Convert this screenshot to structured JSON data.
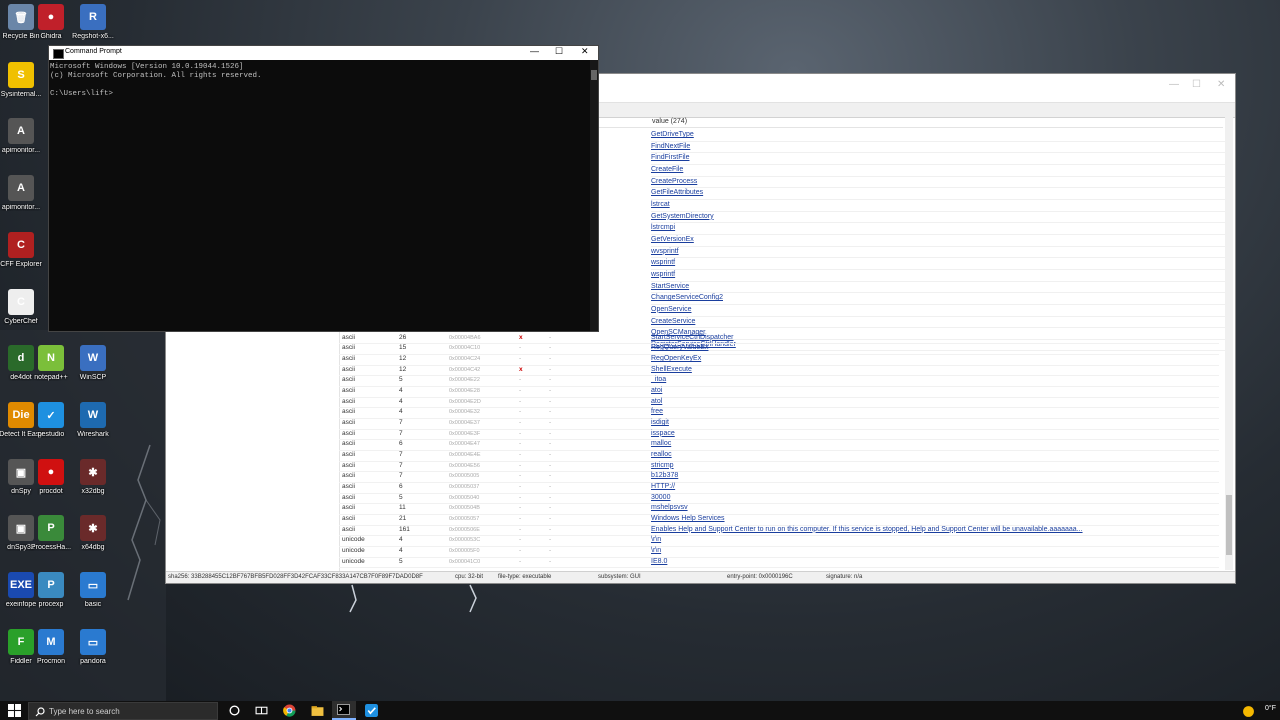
{
  "desktop": {
    "icons": [
      {
        "label": "Recycle Bin",
        "glyph": "🗑",
        "color": "#6a86a8"
      },
      {
        "label": "Ghidra",
        "glyph": "●",
        "color": "#c0202a"
      },
      {
        "label": "Regshot-x6...",
        "glyph": "R",
        "color": "#3a6fc0"
      },
      {
        "label": "Sysinternal...",
        "glyph": "S",
        "color": "#f0c000"
      },
      {
        "label": "apimonitor...",
        "glyph": "A",
        "color": "#555"
      },
      {
        "label": "apimonitor...",
        "glyph": "A",
        "color": "#555"
      },
      {
        "label": "CFF Explorer",
        "glyph": "C",
        "color": "#b02020"
      },
      {
        "label": "CyberChef",
        "glyph": "C",
        "color": "#eeeeee"
      },
      {
        "label": "de4dot",
        "glyph": "d",
        "color": "#2a6a2a"
      },
      {
        "label": "notepad++",
        "glyph": "N",
        "color": "#7bbf3a"
      },
      {
        "label": "WinSCP",
        "glyph": "W",
        "color": "#3a6fc0"
      },
      {
        "label": "Detect It Easy",
        "glyph": "Die",
        "color": "#e08a00"
      },
      {
        "label": "pestudio",
        "glyph": "✓",
        "color": "#1e90e0"
      },
      {
        "label": "Wireshark",
        "glyph": "W",
        "color": "#1e6ab0"
      },
      {
        "label": "dnSpy",
        "glyph": "▣",
        "color": "#555"
      },
      {
        "label": "procdot",
        "glyph": "●",
        "color": "#d01010"
      },
      {
        "label": "x32dbg",
        "glyph": "✱",
        "color": "#6a2a2a"
      },
      {
        "label": "dnSpy32",
        "glyph": "▣",
        "color": "#555"
      },
      {
        "label": "ProcessHa...",
        "glyph": "P",
        "color": "#3a8a3a"
      },
      {
        "label": "x64dbg",
        "glyph": "✱",
        "color": "#6a2a2a"
      },
      {
        "label": "exeinfope",
        "glyph": "EXE",
        "color": "#1a4ab0"
      },
      {
        "label": "procexp",
        "glyph": "P",
        "color": "#3a8ac0"
      },
      {
        "label": "basic",
        "glyph": "▭",
        "color": "#2a7ad0"
      },
      {
        "label": "Fiddler",
        "glyph": "F",
        "color": "#2aa02a"
      },
      {
        "label": "Procmon",
        "glyph": "M",
        "color": "#2a7ad0"
      },
      {
        "label": "pandora",
        "glyph": "▭",
        "color": "#2a7ad0"
      }
    ]
  },
  "cmd": {
    "title": "Command Prompt",
    "line1": "Microsoft Windows [Version 10.0.19044.1526]",
    "line2": "(c) Microsoft Corporation. All rights reserved.",
    "line3": "",
    "line4": "C:\\Users\\lift>",
    "minimize": "—",
    "maximize": "☐",
    "close": "✕"
  },
  "pestudio": {
    "header_value": "value (274)",
    "upper_values": [
      "GetDriveType",
      "FindNextFile",
      "FindFirstFile",
      "CreateFile",
      "CreateProcess",
      "GetFileAttributes",
      "lstrcat",
      "GetSystemDirectory",
      "lstrcmpi",
      "GetVersionEx",
      "wvsprintf",
      "wsprintf",
      "wsprintf",
      "StartService",
      "ChangeServiceConfig2",
      "OpenService",
      "CreateService",
      "OpenSCManager",
      "RegisterServiceCtrlHandler"
    ],
    "rows": [
      {
        "enc": "ascii",
        "size": "26",
        "offset": "0x00004BA6",
        "flag": "x",
        "dash": "-",
        "value": "StartServiceCtrlDispatcher"
      },
      {
        "enc": "ascii",
        "size": "15",
        "offset": "0x00004C10",
        "flag": "-",
        "dash": "-",
        "value": "RegQueryValueEx"
      },
      {
        "enc": "ascii",
        "size": "12",
        "offset": "0x00004C24",
        "flag": "-",
        "dash": "-",
        "value": "RegOpenKeyEx"
      },
      {
        "enc": "ascii",
        "size": "12",
        "offset": "0x00004C42",
        "flag": "x",
        "dash": "-",
        "value": "ShellExecute"
      },
      {
        "enc": "ascii",
        "size": "5",
        "offset": "0x00004E22",
        "flag": "-",
        "dash": "-",
        "value": "_itoa"
      },
      {
        "enc": "ascii",
        "size": "4",
        "offset": "0x00004E28",
        "flag": "-",
        "dash": "-",
        "value": "atoi"
      },
      {
        "enc": "ascii",
        "size": "4",
        "offset": "0x00004E2D",
        "flag": "-",
        "dash": "-",
        "value": "atol"
      },
      {
        "enc": "ascii",
        "size": "4",
        "offset": "0x00004E32",
        "flag": "-",
        "dash": "-",
        "value": "free"
      },
      {
        "enc": "ascii",
        "size": "7",
        "offset": "0x00004E37",
        "flag": "-",
        "dash": "-",
        "value": "isdigit"
      },
      {
        "enc": "ascii",
        "size": "7",
        "offset": "0x00004E3F",
        "flag": "-",
        "dash": "-",
        "value": "isspace"
      },
      {
        "enc": "ascii",
        "size": "6",
        "offset": "0x00004E47",
        "flag": "-",
        "dash": "-",
        "value": "malloc"
      },
      {
        "enc": "ascii",
        "size": "7",
        "offset": "0x00004E4E",
        "flag": "-",
        "dash": "-",
        "value": "realloc"
      },
      {
        "enc": "ascii",
        "size": "7",
        "offset": "0x00004E56",
        "flag": "-",
        "dash": "-",
        "value": "stricmp"
      },
      {
        "enc": "ascii",
        "size": "7",
        "offset": "0x00005005",
        "flag": "-",
        "dash": "-",
        "value": "b12b378"
      },
      {
        "enc": "ascii",
        "size": "6",
        "offset": "0x00005037",
        "flag": "-",
        "dash": "-",
        "value": "HTTP://"
      },
      {
        "enc": "ascii",
        "size": "5",
        "offset": "0x00005040",
        "flag": "-",
        "dash": "-",
        "value": "30000"
      },
      {
        "enc": "ascii",
        "size": "11",
        "offset": "0x0000504B",
        "flag": "-",
        "dash": "-",
        "value": "mshelpsvsv"
      },
      {
        "enc": "ascii",
        "size": "21",
        "offset": "0x00005057",
        "flag": "-",
        "dash": "-",
        "value": "Windows Help Services"
      },
      {
        "enc": "ascii",
        "size": "161",
        "offset": "0x0000506E",
        "flag": "-",
        "dash": "-",
        "value": "Enables Help and Support Center to run on this computer. If this service is stopped, Help and Support Center will be unavailable.aaaaaaa..."
      },
      {
        "enc": "unicode",
        "size": "4",
        "offset": "0x0000053C",
        "flag": "-",
        "dash": "-",
        "value": "\\r\\n"
      },
      {
        "enc": "unicode",
        "size": "4",
        "offset": "0x000005F0",
        "flag": "-",
        "dash": "-",
        "value": "\\r\\n"
      },
      {
        "enc": "unicode",
        "size": "5",
        "offset": "0x000041C0",
        "flag": "-",
        "dash": "-",
        "value": "IE8.0"
      }
    ],
    "status": {
      "sha256": "sha256: 33B288455C12BF767BFB5FD028FF3D42FCAF33CF833A147CB7F0F89F7DAD0D8F",
      "cpu": "cpu: 32-bit",
      "filetype": "file-type: executable",
      "subsystem": "subsystem: GUI",
      "entry": "entry-point: 0x0000196C",
      "signature": "signature: n/a"
    },
    "win_min": "—",
    "win_max": "☐",
    "win_close": "✕"
  },
  "taskbar": {
    "search_placeholder": "Type here to search",
    "weather": "0°F"
  }
}
